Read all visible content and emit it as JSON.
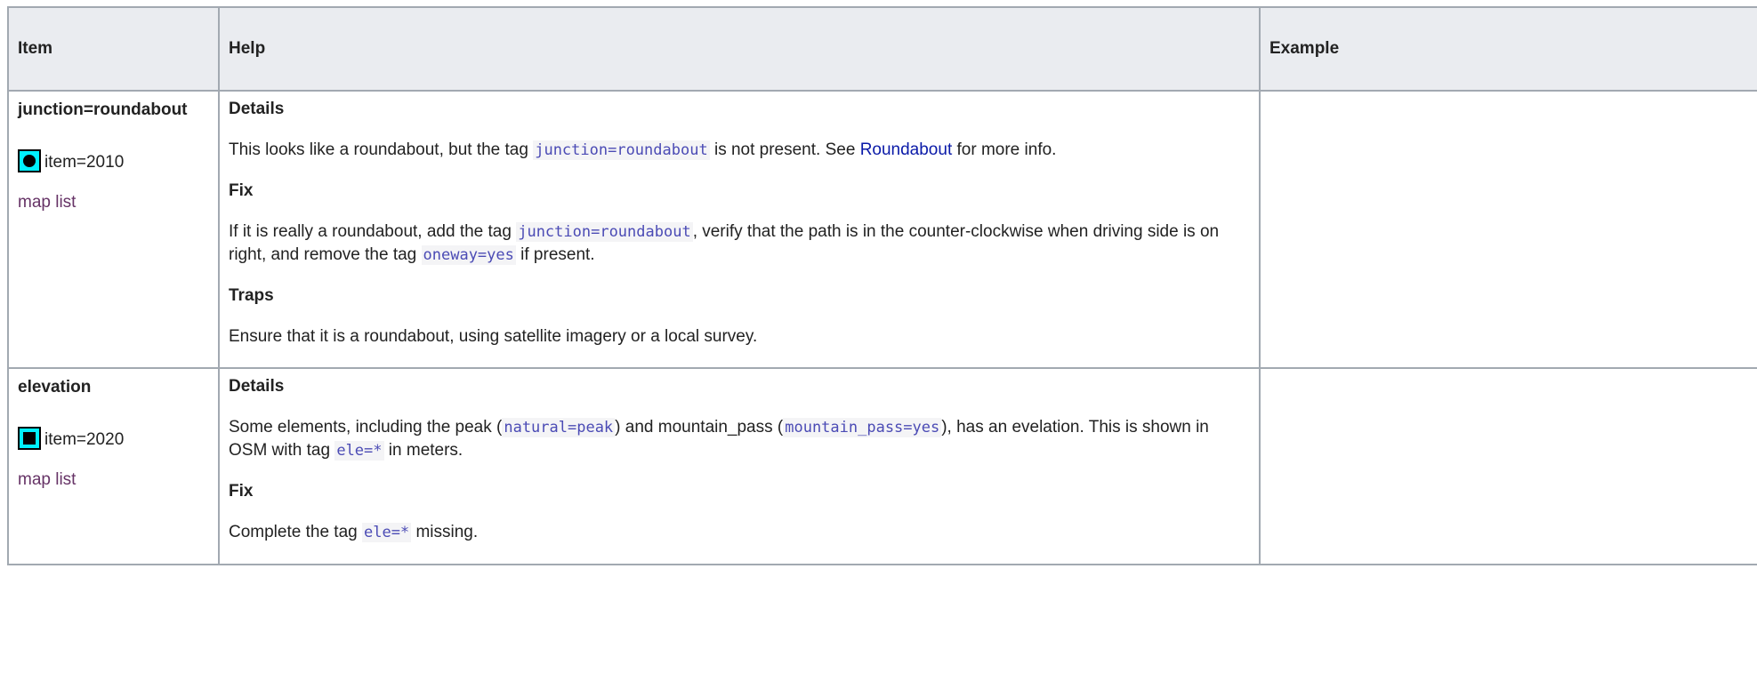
{
  "header": {
    "item": "Item",
    "help": "Help",
    "example": "Example"
  },
  "rows": [
    {
      "title": "junction=roundabout",
      "item_code": "item=2010",
      "map_list": "map list",
      "details_head": "Details",
      "details_text_1": "This looks like a roundabout, but the tag ",
      "details_code_1": "junction=roundabout",
      "details_text_2": " is not present. See ",
      "details_link": "Roundabout",
      "details_text_3": " for more info.",
      "fix_head": "Fix",
      "fix_text_1": "If it is really a roundabout, add the tag ",
      "fix_code_1": "junction=roundabout",
      "fix_text_2": ", verify that the path is in the counter-clockwise when driving side is on right, and remove the tag ",
      "fix_code_2": "oneway=yes",
      "fix_text_3": " if present.",
      "traps_head": "Traps",
      "traps_text": "Ensure that it is a roundabout, using satellite imagery or a local survey."
    },
    {
      "title": "elevation",
      "item_code": "item=2020",
      "map_list": "map list",
      "details_head": "Details",
      "details_text_1": "Some elements, including the peak (",
      "details_code_1": "natural=peak",
      "details_text_2": ") and mountain_pass (",
      "details_code_2": "mountain_pass=yes",
      "details_text_3": "), has an evelation. This is shown in OSM with tag ",
      "details_code_3": "ele=*",
      "details_text_4": " in meters.",
      "fix_head": "Fix",
      "fix_text_1": "Complete the tag ",
      "fix_code_1": "ele=*",
      "fix_text_2": " missing."
    }
  ],
  "colors": {
    "marker_fill": "#00f0ff",
    "header_bg": "#eaecf0",
    "border": "#a2a9b1",
    "code_color": "#4b4bb5",
    "visited_link": "#663366",
    "wiki_link": "#0a1aa8"
  },
  "icons": [
    "marker-circle-icon",
    "marker-square-icon"
  ]
}
